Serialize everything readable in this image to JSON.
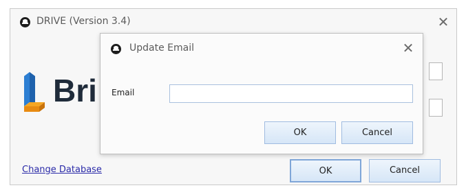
{
  "main_window": {
    "title": "DRIVE (Version 3.4)",
    "logo_text": "Bri",
    "change_database_link": "Change Database",
    "ok_label": "OK",
    "cancel_label": "Cancel",
    "close_glyph": "✕"
  },
  "dialog": {
    "title": "Update Email",
    "close_glyph": "✕",
    "email_label": "Email",
    "email_value": "",
    "ok_label": "OK",
    "cancel_label": "Cancel"
  },
  "colors": {
    "button_border": "#9fbbe0",
    "link": "#2a2aa8",
    "logo_blue": "#2d7fd3",
    "logo_orange": "#f5a623"
  }
}
